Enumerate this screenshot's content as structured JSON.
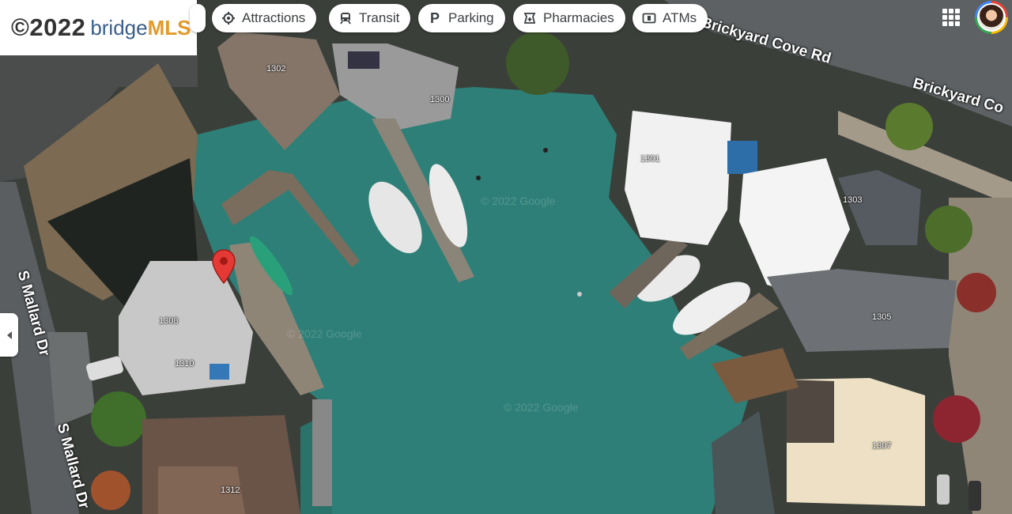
{
  "logo": {
    "year": "©2022",
    "brand_a": "bridge",
    "brand_b": "MLS"
  },
  "chips": [
    {
      "label": "Attractions",
      "icon": "attractions-icon"
    },
    {
      "label": "Transit",
      "icon": "transit-icon"
    },
    {
      "label": "Parking",
      "icon": "parking-icon"
    },
    {
      "label": "Pharmacies",
      "icon": "pharmacy-icon"
    },
    {
      "label": "ATMs",
      "icon": "atm-icon"
    }
  ],
  "roads": {
    "road_1": "Brickyard Cove Rd",
    "road_2": "Brickyard Co",
    "road_3": "S Mallard Dr",
    "road_4": "S Mallard Dr"
  },
  "house_numbers": {
    "n1302": "1302",
    "n1300": "1300",
    "n1301": "1301",
    "n1303": "1303",
    "n1305": "1305",
    "n1307": "1307",
    "n1308": "1308",
    "n1310": "1310",
    "n1312": "1312"
  },
  "watermark": "© 2022 Google",
  "colors": {
    "water": "#2e7f77",
    "pin": "#e53935"
  }
}
